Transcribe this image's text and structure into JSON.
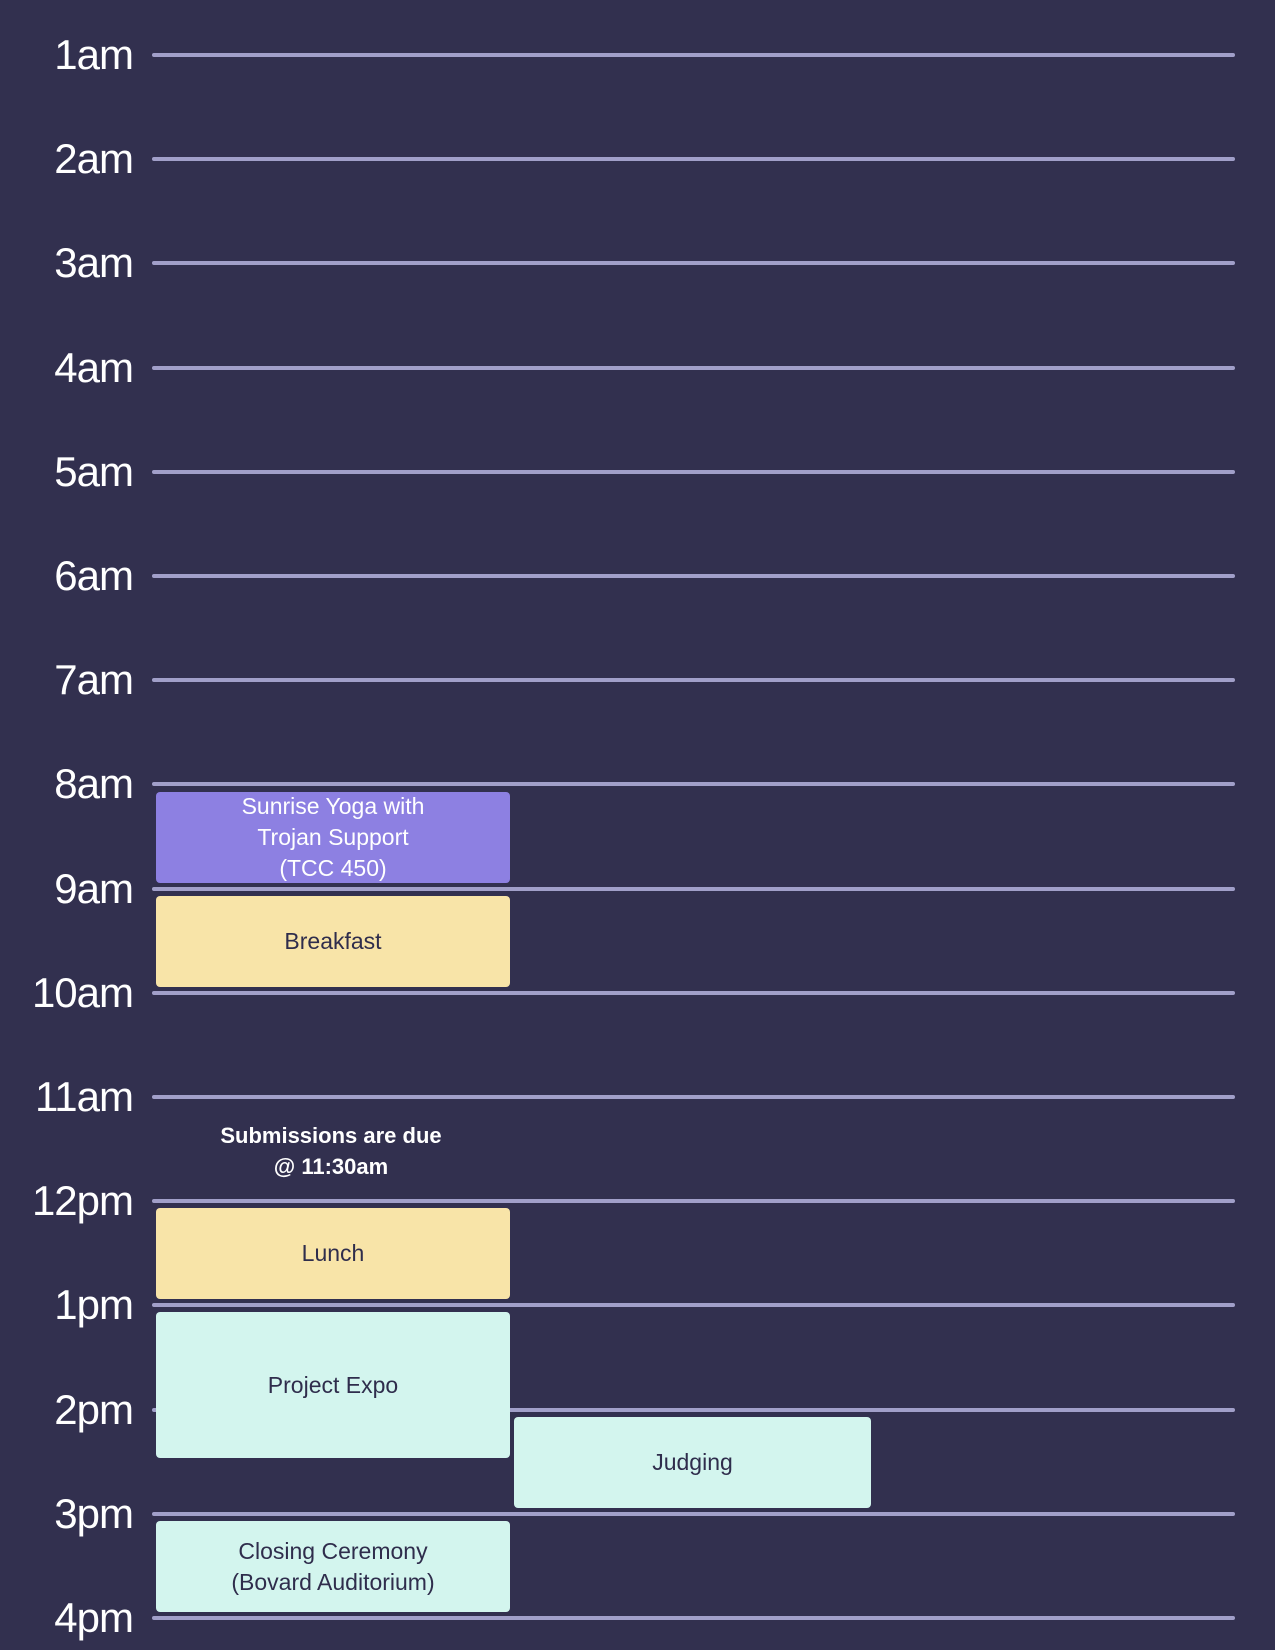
{
  "schedule": {
    "hours": [
      "1am",
      "2am",
      "3am",
      "4am",
      "5am",
      "6am",
      "7am",
      "8am",
      "9am",
      "10am",
      "11am",
      "12pm",
      "1pm",
      "2pm",
      "3pm",
      "4pm"
    ],
    "events": {
      "yoga": "Sunrise Yoga with\nTrojan Support\n(TCC 450)",
      "breakfast": "Breakfast",
      "lunch": "Lunch",
      "expo": "Project Expo",
      "judging": "Judging",
      "closing": "Closing Ceremony\n(Bovard Auditorium)"
    },
    "note": "Submissions are due\n@ 11:30am"
  },
  "colors": {
    "background": "#32304f",
    "gridline": "#a19fc9",
    "yoga": "#8d80e2",
    "meal": "#f8e4a8",
    "activity": "#d3f5ee"
  }
}
